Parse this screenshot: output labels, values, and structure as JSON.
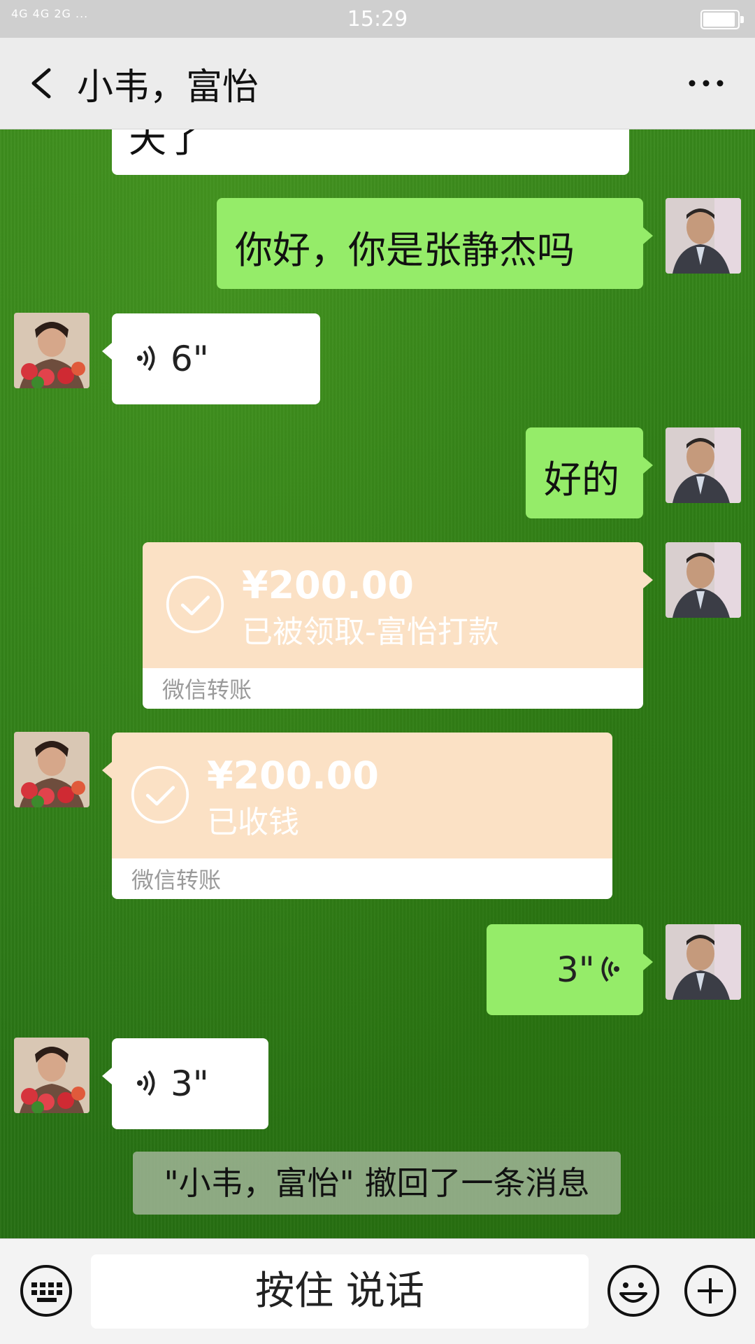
{
  "status_bar": {
    "network": "4G 4G 2G ...",
    "time": "15:29",
    "battery_level": 0.9
  },
  "header": {
    "title": "小韦，富怡"
  },
  "messages": {
    "top_fragment": "天了",
    "m1_text": "你好，你是张静杰吗",
    "m2_voice": "6\"",
    "m3_text": "好的",
    "t1_amount": "¥200.00",
    "t1_desc": "已被领取-富怡打款",
    "t1_label": "微信转账",
    "t2_amount": "¥200.00",
    "t2_desc": "已收钱",
    "t2_label": "微信转账",
    "m4_voice": "3\"",
    "m5_voice": "3\""
  },
  "system": {
    "recall_notice": "\"小韦，富怡\" 撤回了一条消息"
  },
  "input_bar": {
    "talk_label": "按住 说话"
  },
  "colors": {
    "green_bubble": "#95ec69",
    "transfer_peach": "#fbe1c5",
    "header_bg": "#ececec"
  },
  "icons": [
    "back-arrow-icon",
    "more-icon",
    "voice-wave-icon",
    "check-circle-icon",
    "keyboard-icon",
    "emoji-icon",
    "plus-icon"
  ]
}
